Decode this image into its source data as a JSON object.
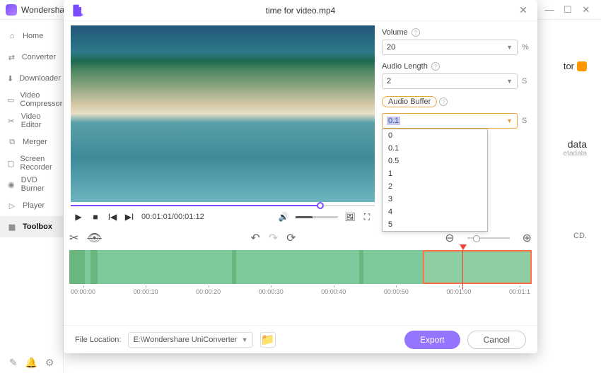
{
  "app": {
    "title": "Wondershare UniConverter"
  },
  "titlebar_icons": {
    "help": "?",
    "menu": "≡",
    "min": "—",
    "max": "☐",
    "close": "✕"
  },
  "sidebar": {
    "items": [
      {
        "icon": "home",
        "label": "Home"
      },
      {
        "icon": "convert",
        "label": "Converter"
      },
      {
        "icon": "download",
        "label": "Downloader"
      },
      {
        "icon": "compress",
        "label": "Video Compressor"
      },
      {
        "icon": "edit",
        "label": "Video Editor"
      },
      {
        "icon": "merge",
        "label": "Merger"
      },
      {
        "icon": "record",
        "label": "Screen Recorder"
      },
      {
        "icon": "dvd",
        "label": "DVD Burner"
      },
      {
        "icon": "play",
        "label": "Player"
      },
      {
        "icon": "toolbox",
        "label": "Toolbox"
      }
    ]
  },
  "peek": {
    "tor": "tor",
    "data": "data",
    "datasub": "etadata",
    "cd": "CD."
  },
  "modal": {
    "title": "time for video.mp4",
    "time_display": "00:01:01/00:01:12",
    "volume": {
      "label": "Volume",
      "value": "20",
      "unit": "%"
    },
    "audio_length": {
      "label": "Audio Length",
      "value": "2",
      "unit": "S"
    },
    "audio_buffer": {
      "label": "Audio Buffer",
      "value": "0.1",
      "unit": "S",
      "options": [
        "0",
        "0.1",
        "0.5",
        "1",
        "2",
        "3",
        "4",
        "5"
      ]
    },
    "ruler": [
      "00:00:00",
      "00:00:10",
      "00:00:20",
      "00:00:30",
      "00:00:40",
      "00:00:50",
      "00:01:00",
      "00:01:1"
    ],
    "file_location_label": "File Location:",
    "file_location": "E:\\Wondershare UniConverter",
    "export": "Export",
    "cancel": "Cancel"
  }
}
